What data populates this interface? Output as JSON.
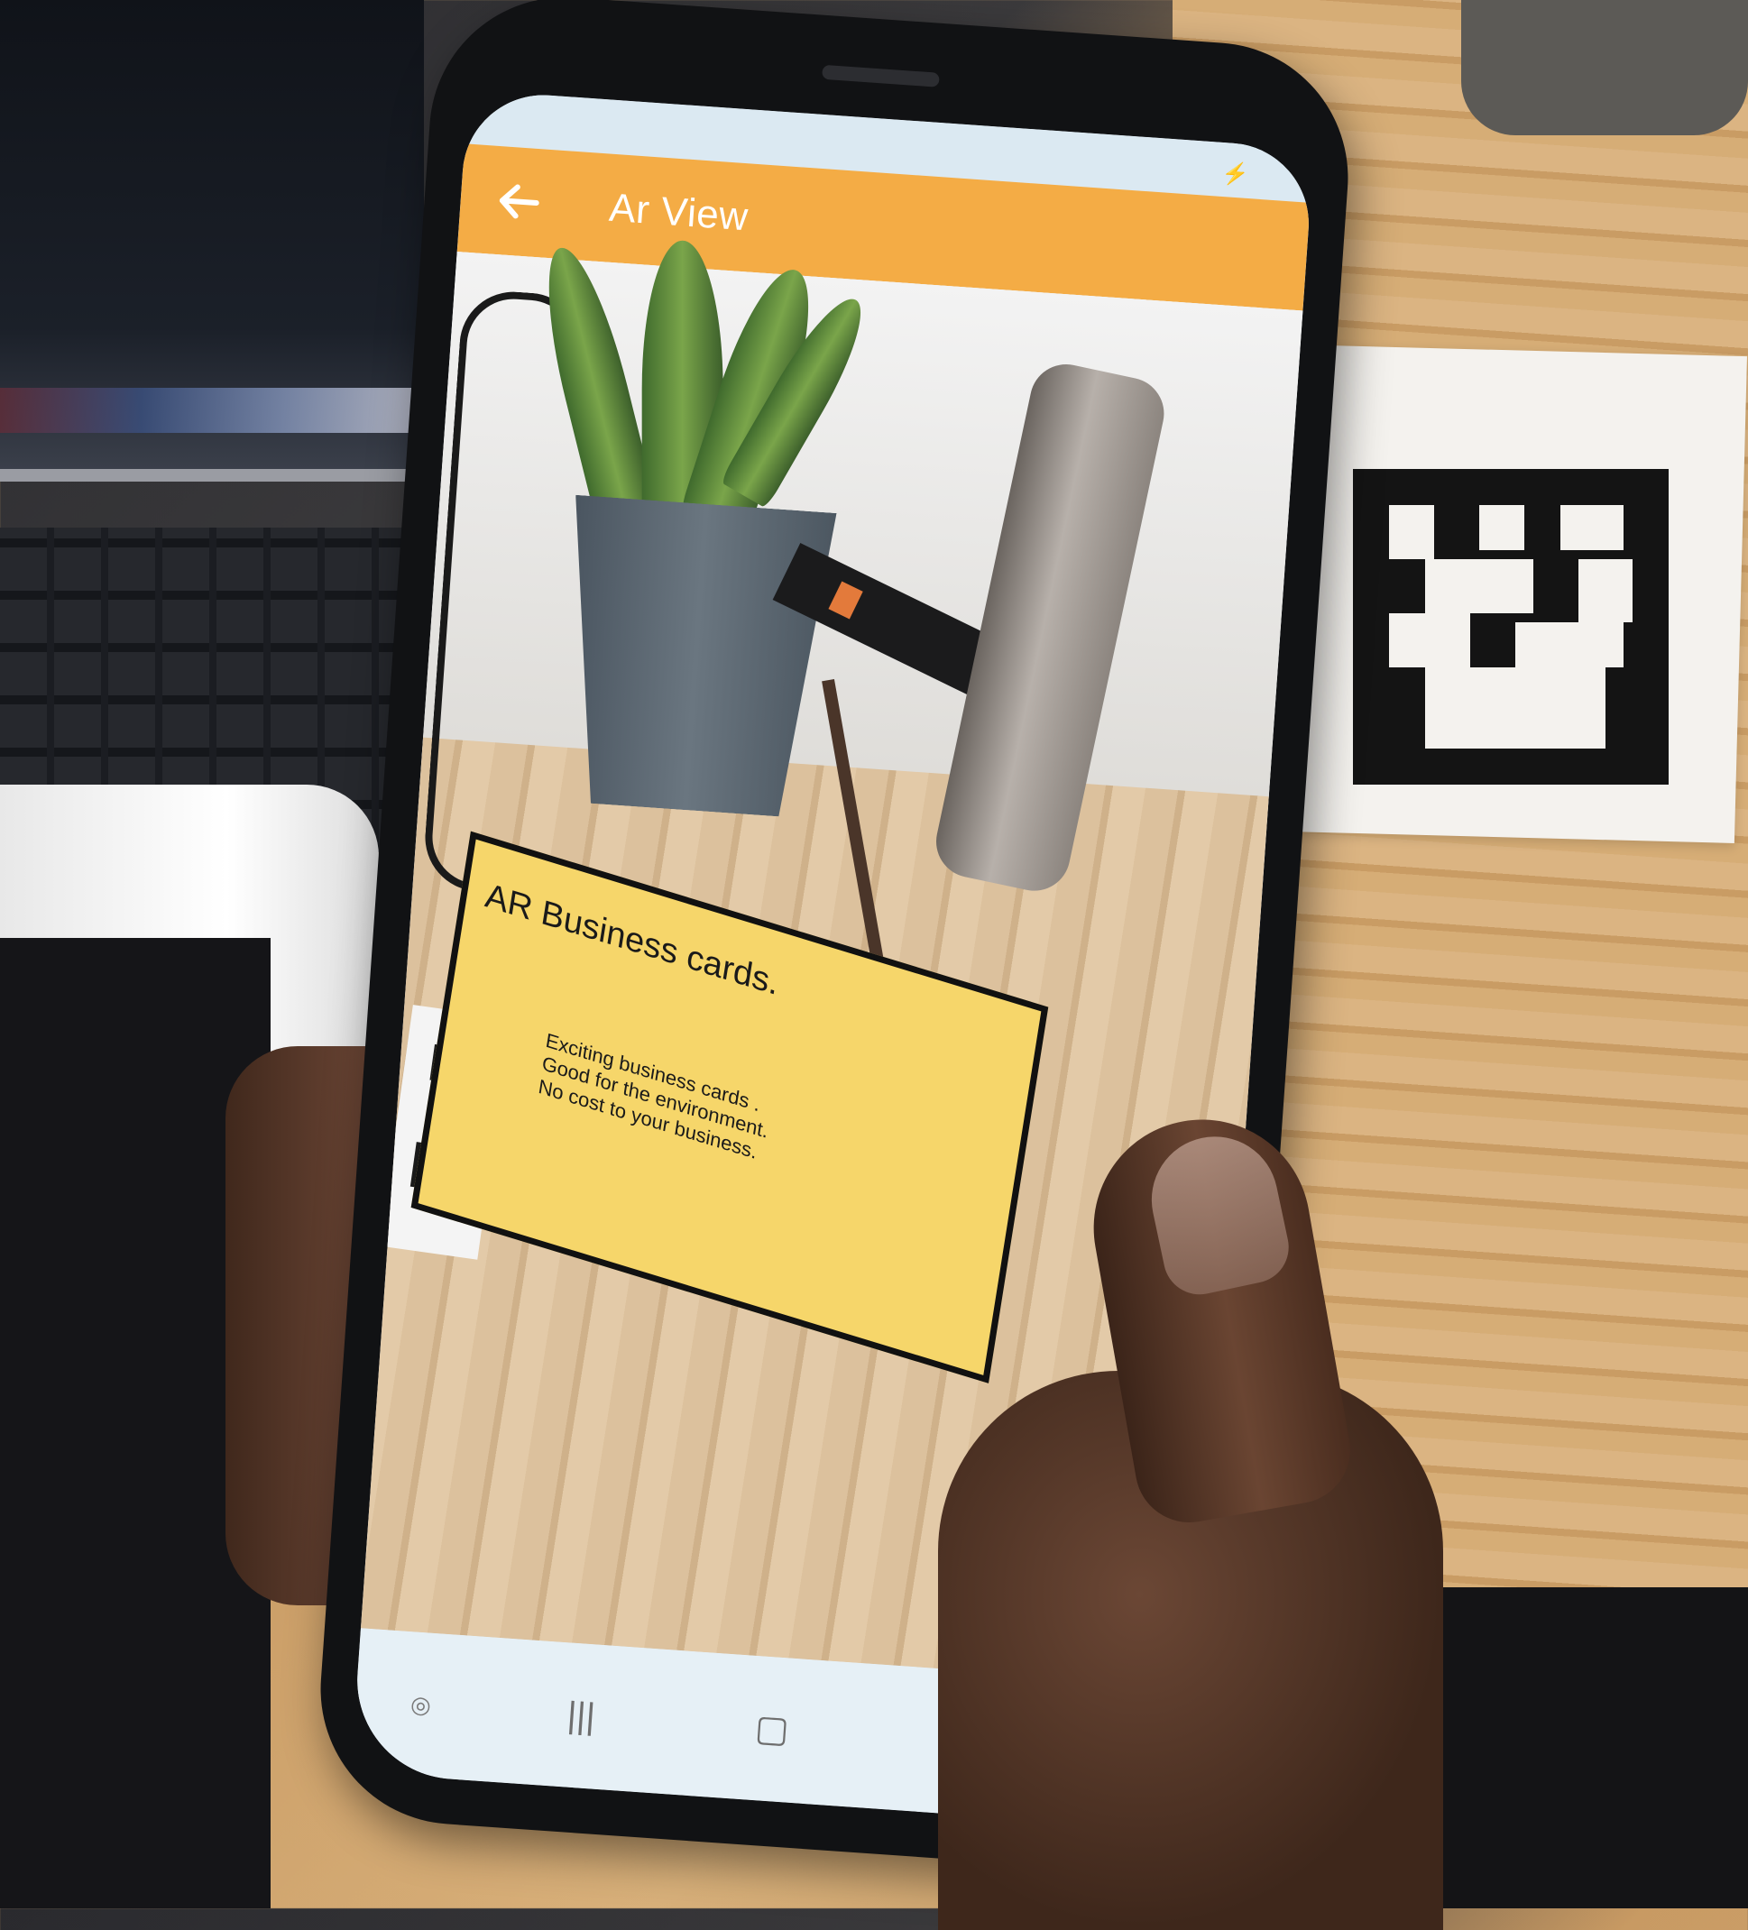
{
  "app": {
    "title": "Ar View",
    "icons": {
      "back": "arrow-left-icon",
      "status": "charging-icon"
    }
  },
  "ar_card": {
    "title": "AR Business cards.",
    "lines": [
      "Exciting business cards .",
      "Good for the environment.",
      "No cost to your business."
    ],
    "background_color": "#f6d66a",
    "border_color": "#111111"
  },
  "navbar": {
    "recents_glyph": "|||",
    "home_glyph": "▢",
    "back_glyph": "<"
  },
  "colors": {
    "appbar": "#f4ac45",
    "navbar": "#e6f0f6"
  }
}
